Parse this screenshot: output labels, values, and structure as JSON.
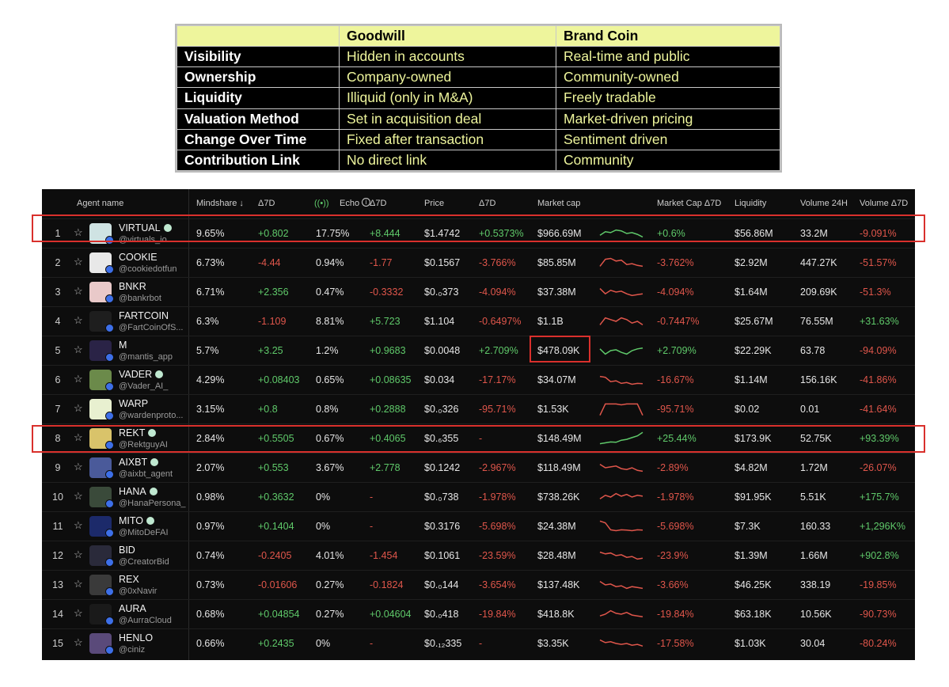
{
  "comparison": {
    "headers": [
      "",
      "Goodwill",
      "Brand Coin"
    ],
    "rows": [
      [
        "Visibility",
        "Hidden in accounts",
        "Real-time and public"
      ],
      [
        "Ownership",
        "Company-owned",
        "Community-owned"
      ],
      [
        "Liquidity",
        "Illiquid (only in M&A)",
        "Freely tradable"
      ],
      [
        "Valuation Method",
        "Set in acquisition deal",
        "Market-driven pricing"
      ],
      [
        "Change Over Time",
        "Fixed after transaction",
        "Sentiment driven"
      ],
      [
        "Contribution Link",
        "No direct link",
        "Community"
      ]
    ]
  },
  "agents": {
    "columns": {
      "agent_name": "Agent name",
      "mindshare": "Mindshare ↓",
      "d7_1": "Δ7D",
      "echo": "Echo",
      "d7_2": "Δ7D",
      "price": "Price",
      "d7_3": "Δ7D",
      "market_cap": "Market cap",
      "market_cap_d7": "Market Cap Δ7D",
      "liquidity": "Liquidity",
      "volume_24h": "Volume 24H",
      "volume_d7": "Volume Δ7D"
    },
    "colors": {
      "positive": "#5fc96a",
      "negative": "#e0564b",
      "highlight": "#d9302c"
    },
    "rows": [
      {
        "rank": "1",
        "name": "VIRTUAL",
        "handle": "@virtuals_io",
        "verified": true,
        "avatar": "#cfe3e3",
        "mindshare": "9.65%",
        "d7a": "+0.802",
        "echo": "17.75%",
        "d7b": "+8.444",
        "price": "$1.4742",
        "d7c": "+0.5373%",
        "mcap": "$966.69M",
        "mcapd": "+0.6%",
        "liq": "$56.86M",
        "vol": "33.2M",
        "vold": "-9.091%",
        "trend": "pos",
        "spark": [
          0.6,
          0.4,
          0.45,
          0.3,
          0.35,
          0.5,
          0.45,
          0.55,
          0.7
        ]
      },
      {
        "rank": "2",
        "name": "COOKIE",
        "handle": "@cookiedotfun",
        "verified": false,
        "avatar": "#e8e8e8",
        "mindshare": "6.73%",
        "d7a": "-4.44",
        "echo": "0.94%",
        "d7b": "-1.77",
        "price": "$0.1567",
        "d7c": "-3.766%",
        "mcap": "$85.85M",
        "mcapd": "-3.762%",
        "liq": "$2.92M",
        "vol": "447.27K",
        "vold": "-51.57%",
        "trend": "neg",
        "spark": [
          0.7,
          0.3,
          0.25,
          0.4,
          0.35,
          0.6,
          0.55,
          0.65,
          0.7
        ]
      },
      {
        "rank": "3",
        "name": "BNKR",
        "handle": "@bankrbot",
        "verified": false,
        "avatar": "#e9c9c9",
        "mindshare": "6.71%",
        "d7a": "+2.356",
        "echo": "0.47%",
        "d7b": "-0.3332",
        "price": "$0.₀373",
        "d7c": "-4.094%",
        "mcap": "$37.38M",
        "mcapd": "-4.094%",
        "liq": "$1.64M",
        "vol": "209.69K",
        "vold": "-51.3%",
        "trend": "neg",
        "spark": [
          0.3,
          0.6,
          0.4,
          0.5,
          0.45,
          0.6,
          0.7,
          0.65,
          0.6
        ]
      },
      {
        "rank": "4",
        "name": "FARTCOIN",
        "handle": "@FartCoinOfS...",
        "verified": false,
        "avatar": "#1e1e1e",
        "mindshare": "6.3%",
        "d7a": "-1.109",
        "echo": "8.81%",
        "d7b": "+5.723",
        "price": "$1.104",
        "d7c": "-0.6497%",
        "mcap": "$1.1B",
        "mcapd": "-0.7447%",
        "liq": "$25.67M",
        "vol": "76.55M",
        "vold": "+31.63%",
        "trend": "neg",
        "spark": [
          0.7,
          0.3,
          0.4,
          0.5,
          0.3,
          0.4,
          0.6,
          0.5,
          0.7
        ]
      },
      {
        "rank": "5",
        "name": "M",
        "handle": "@mantis_app",
        "verified": false,
        "avatar": "#2a2346",
        "mindshare": "5.7%",
        "d7a": "+3.25",
        "echo": "1.2%",
        "d7b": "+0.9683",
        "price": "$0.0048",
        "d7c": "+2.709%",
        "mcap": "$478.09K",
        "mcapd": "+2.709%",
        "liq": "$22.29K",
        "vol": "63.78",
        "vold": "-94.09%",
        "trend": "pos",
        "spark": [
          0.4,
          0.7,
          0.5,
          0.45,
          0.6,
          0.7,
          0.5,
          0.4,
          0.35
        ]
      },
      {
        "rank": "6",
        "name": "VADER",
        "handle": "@Vader_AI_",
        "verified": true,
        "avatar": "#6b8a4a",
        "mindshare": "4.29%",
        "d7a": "+0.08403",
        "echo": "0.65%",
        "d7b": "+0.08635",
        "price": "$0.034",
        "d7c": "-17.17%",
        "mcap": "$34.07M",
        "mcapd": "-16.67%",
        "liq": "$1.14M",
        "vol": "156.16K",
        "vold": "-41.86%",
        "trend": "neg",
        "spark": [
          0.3,
          0.35,
          0.6,
          0.55,
          0.7,
          0.65,
          0.75,
          0.7,
          0.72
        ]
      },
      {
        "rank": "7",
        "name": "WARP",
        "handle": "@wardenproto...",
        "verified": false,
        "avatar": "#e8f0d0",
        "mindshare": "3.15%",
        "d7a": "+0.8",
        "echo": "0.8%",
        "d7b": "+0.2888",
        "price": "$0.₀326",
        "d7c": "-95.71%",
        "mcap": "$1.53K",
        "mcapd": "-95.71%",
        "liq": "$0.02",
        "vol": "0.01",
        "vold": "-41.64%",
        "trend": "neg",
        "spark": [
          0.85,
          0.2,
          0.2,
          0.2,
          0.25,
          0.2,
          0.2,
          0.2,
          0.85
        ]
      },
      {
        "rank": "8",
        "name": "REKT",
        "handle": "@RektguyAI",
        "verified": true,
        "avatar": "#d9c36a",
        "mindshare": "2.84%",
        "d7a": "+0.5505",
        "echo": "0.67%",
        "d7b": "+0.4065",
        "price": "$0.₆355",
        "d7c": "-",
        "mcap": "$148.49M",
        "mcapd": "+25.44%",
        "liq": "$173.9K",
        "vol": "52.75K",
        "vold": "+93.39%",
        "trend": "pos",
        "spark": [
          0.8,
          0.75,
          0.7,
          0.72,
          0.6,
          0.55,
          0.45,
          0.35,
          0.15
        ]
      },
      {
        "rank": "9",
        "name": "AIXBT",
        "handle": "@aixbt_agent",
        "verified": true,
        "avatar": "#4a5a9a",
        "mindshare": "2.07%",
        "d7a": "+0.553",
        "echo": "3.67%",
        "d7b": "+2.778",
        "price": "$0.1242",
        "d7c": "-2.967%",
        "mcap": "$118.49M",
        "mcapd": "-2.89%",
        "liq": "$4.82M",
        "vol": "1.72M",
        "vold": "-26.07%",
        "trend": "neg",
        "spark": [
          0.3,
          0.5,
          0.45,
          0.4,
          0.55,
          0.6,
          0.5,
          0.65,
          0.7
        ]
      },
      {
        "rank": "10",
        "name": "HANA",
        "handle": "@HanaPersona_",
        "verified": true,
        "avatar": "#3a4a3a",
        "mindshare": "0.98%",
        "d7a": "+0.3632",
        "echo": "0%",
        "d7b": "-",
        "price": "$0.₀738",
        "d7c": "-1.978%",
        "mcap": "$738.26K",
        "mcapd": "-1.978%",
        "liq": "$91.95K",
        "vol": "5.51K",
        "vold": "+175.7%",
        "trend": "neg",
        "spark": [
          0.6,
          0.4,
          0.5,
          0.3,
          0.45,
          0.35,
          0.5,
          0.4,
          0.45
        ]
      },
      {
        "rank": "11",
        "name": "MITO",
        "handle": "@MitoDeFAI",
        "verified": true,
        "avatar": "#1c2a6a",
        "mindshare": "0.97%",
        "d7a": "+0.1404",
        "echo": "0%",
        "d7b": "-",
        "price": "$0.3176",
        "d7c": "-5.698%",
        "mcap": "$24.38M",
        "mcapd": "-5.698%",
        "liq": "$7.3K",
        "vol": "160.33",
        "vold": "+1,296K%",
        "trend": "neg",
        "spark": [
          0.2,
          0.3,
          0.7,
          0.75,
          0.7,
          0.72,
          0.75,
          0.7,
          0.72
        ]
      },
      {
        "rank": "12",
        "name": "BID",
        "handle": "@CreatorBid",
        "verified": false,
        "avatar": "#2a2a3a",
        "mindshare": "0.74%",
        "d7a": "-0.2405",
        "echo": "4.01%",
        "d7b": "-1.454",
        "price": "$0.1061",
        "d7c": "-23.59%",
        "mcap": "$28.48M",
        "mcapd": "-23.9%",
        "liq": "$1.39M",
        "vol": "1.66M",
        "vold": "+902.8%",
        "trend": "neg",
        "spark": [
          0.3,
          0.4,
          0.35,
          0.5,
          0.45,
          0.6,
          0.55,
          0.7,
          0.65
        ]
      },
      {
        "rank": "13",
        "name": "REX",
        "handle": "@0xNavir",
        "verified": false,
        "avatar": "#3a3a3a",
        "mindshare": "0.73%",
        "d7a": "-0.01606",
        "echo": "0.27%",
        "d7b": "-0.1824",
        "price": "$0.₀144",
        "d7c": "-3.654%",
        "mcap": "$137.48K",
        "mcapd": "-3.66%",
        "liq": "$46.25K",
        "vol": "338.19",
        "vold": "-19.85%",
        "trend": "neg",
        "spark": [
          0.3,
          0.5,
          0.45,
          0.6,
          0.55,
          0.7,
          0.6,
          0.65,
          0.7
        ]
      },
      {
        "rank": "14",
        "name": "AURA",
        "handle": "@AurraCloud",
        "verified": false,
        "avatar": "#1a1a1a",
        "mindshare": "0.68%",
        "d7a": "+0.04854",
        "echo": "0.27%",
        "d7b": "+0.04604",
        "price": "$0.₀418",
        "d7c": "-19.84%",
        "mcap": "$418.8K",
        "mcapd": "-19.84%",
        "liq": "$63.18K",
        "vol": "10.56K",
        "vold": "-90.73%",
        "trend": "neg",
        "spark": [
          0.6,
          0.5,
          0.3,
          0.45,
          0.5,
          0.4,
          0.55,
          0.6,
          0.65
        ]
      },
      {
        "rank": "15",
        "name": "HENLO",
        "handle": "@ciniz",
        "verified": false,
        "avatar": "#5a4a7a",
        "mindshare": "0.66%",
        "d7a": "+0.2435",
        "echo": "0%",
        "d7b": "-",
        "price": "$0.₁₂335",
        "d7c": "-",
        "mcap": "$3.35K",
        "mcapd": "-17.58%",
        "liq": "$1.03K",
        "vol": "30.04",
        "vold": "-80.24%",
        "trend": "neg",
        "spark": [
          0.3,
          0.45,
          0.4,
          0.5,
          0.55,
          0.5,
          0.6,
          0.55,
          0.65
        ]
      }
    ]
  }
}
